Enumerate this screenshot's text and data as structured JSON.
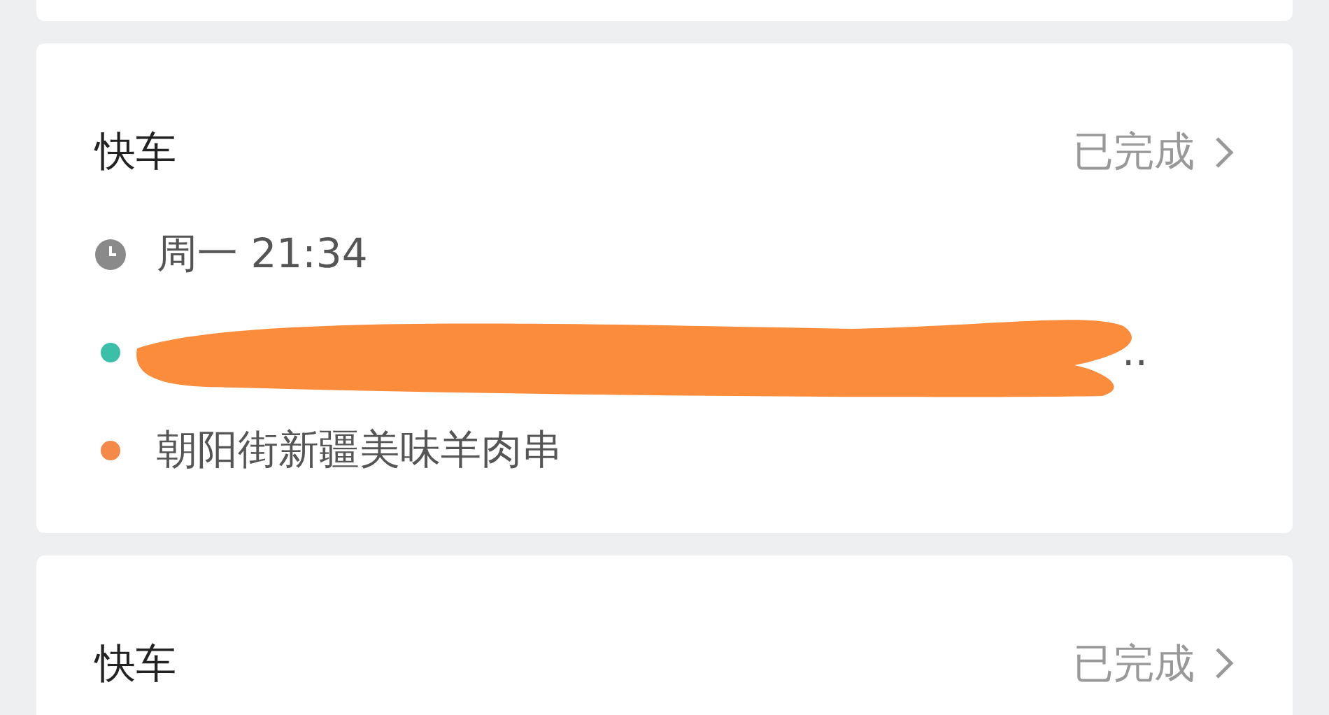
{
  "orders": [
    {
      "kind": "partial"
    },
    {
      "kind": "full",
      "service": "快车",
      "status": "已完成",
      "rows": [
        {
          "kind": "time",
          "text": "周一 21:34"
        },
        {
          "kind": "redacted",
          "text": "..",
          "color": "#3cbfa8"
        },
        {
          "kind": "place",
          "text": "朝阳街新疆美味羊肉串",
          "color": "#f5894a"
        }
      ]
    },
    {
      "kind": "full",
      "service": "快车",
      "status": "已完成"
    }
  ]
}
